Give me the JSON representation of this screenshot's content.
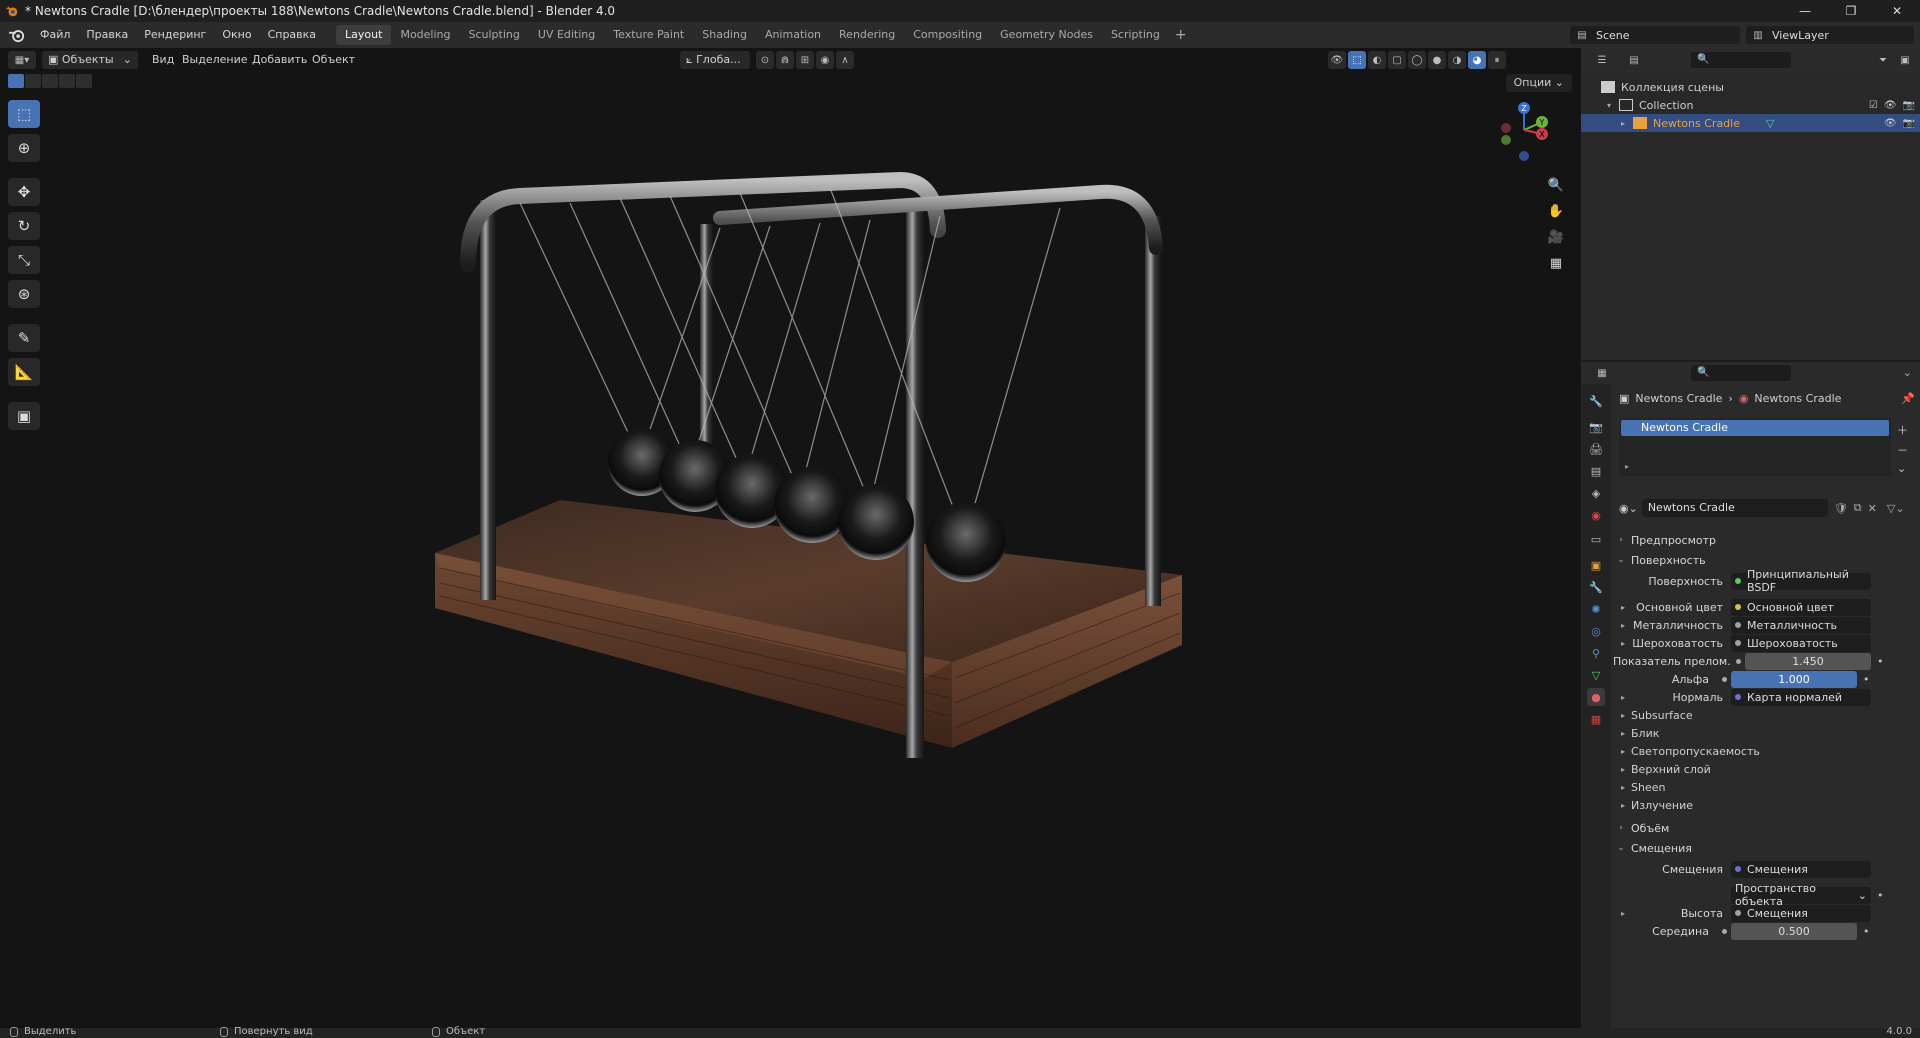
{
  "window": {
    "title": "* Newtons Cradle [D:\\блендер\\проекты 188\\Newtons Cradle\\Newtons Cradle.blend] - Blender 4.0",
    "minimize": "—",
    "maximize": "❐",
    "close": "✕"
  },
  "menu": [
    "Файл",
    "Правка",
    "Рендеринг",
    "Окно",
    "Справка"
  ],
  "workspaces": [
    {
      "label": "Layout",
      "active": true
    },
    {
      "label": "Modeling"
    },
    {
      "label": "Sculpting"
    },
    {
      "label": "UV Editing"
    },
    {
      "label": "Texture Paint"
    },
    {
      "label": "Shading"
    },
    {
      "label": "Animation"
    },
    {
      "label": "Rendering"
    },
    {
      "label": "Compositing"
    },
    {
      "label": "Geometry Nodes"
    },
    {
      "label": "Scripting"
    }
  ],
  "add_workspace": "+",
  "scene": {
    "name": "Scene",
    "view_layer": "ViewLayer"
  },
  "viewport": {
    "mode": "Объекты",
    "menus": [
      "Вид",
      "Выделение",
      "Добавить",
      "Объект"
    ],
    "transform_orientation": "Глоба...",
    "options": "Опции"
  },
  "gizmo": {
    "z": "Z",
    "y": "Y",
    "x": "X"
  },
  "outliner": {
    "root": "Коллекция сцены",
    "collection": "Collection",
    "object": "Newtons Cradle"
  },
  "properties": {
    "breadcrumb": [
      "Newtons Cradle",
      "Newtons Cradle"
    ],
    "slot": "Newtons Cradle",
    "material_name": "Newtons Cradle",
    "panels": {
      "preview": "Предпросмотр",
      "surface": "Поверхность",
      "volume": "Объём",
      "displacement": "Смещения"
    },
    "surface_rows": [
      {
        "label": "Поверхность",
        "value": "Принципиальный BSDF",
        "dot": "#5cc85c"
      },
      {
        "label": "Основной цвет",
        "value": "Основной цвет",
        "dot": "#d6c24a",
        "expand": true
      },
      {
        "label": "Металличность",
        "value": "Металличность",
        "dot": "#a1a1a1",
        "expand": true
      },
      {
        "label": "Шероховатость",
        "value": "Шероховатость",
        "dot": "#a1a1a1",
        "expand": true
      },
      {
        "label": "Показатель прелом...",
        "value": "1.450",
        "num": true
      },
      {
        "label": "Альфа",
        "value": "1.000",
        "num": true,
        "blue": true
      },
      {
        "label": "Нормаль",
        "value": "Карта нормалей",
        "dot": "#6e6ed8",
        "expand": true
      }
    ],
    "sub_panels": [
      "Subsurface",
      "Блик",
      "Светопропускаемость",
      "Верхний слой",
      "Sheen",
      "Излучение"
    ],
    "displacement_rows": [
      {
        "label": "Смещения",
        "value": "Смещения",
        "dot": "#6e6ed8"
      },
      {
        "label": "",
        "value": "Пространство объекта",
        "dropdown": true
      },
      {
        "label": "Высота",
        "value": "Смещения",
        "dot": "#a1a1a1",
        "expand": true
      },
      {
        "label": "Середина",
        "value": "0.500",
        "num": true
      }
    ]
  },
  "status": {
    "select": "Выделить",
    "rotate": "Повернуть вид",
    "object": "Объект",
    "version": "4.0.0"
  },
  "colors": {
    "accent": "#4772b3",
    "selection_row": "#334d80",
    "object_orange": "#e8a33a"
  }
}
